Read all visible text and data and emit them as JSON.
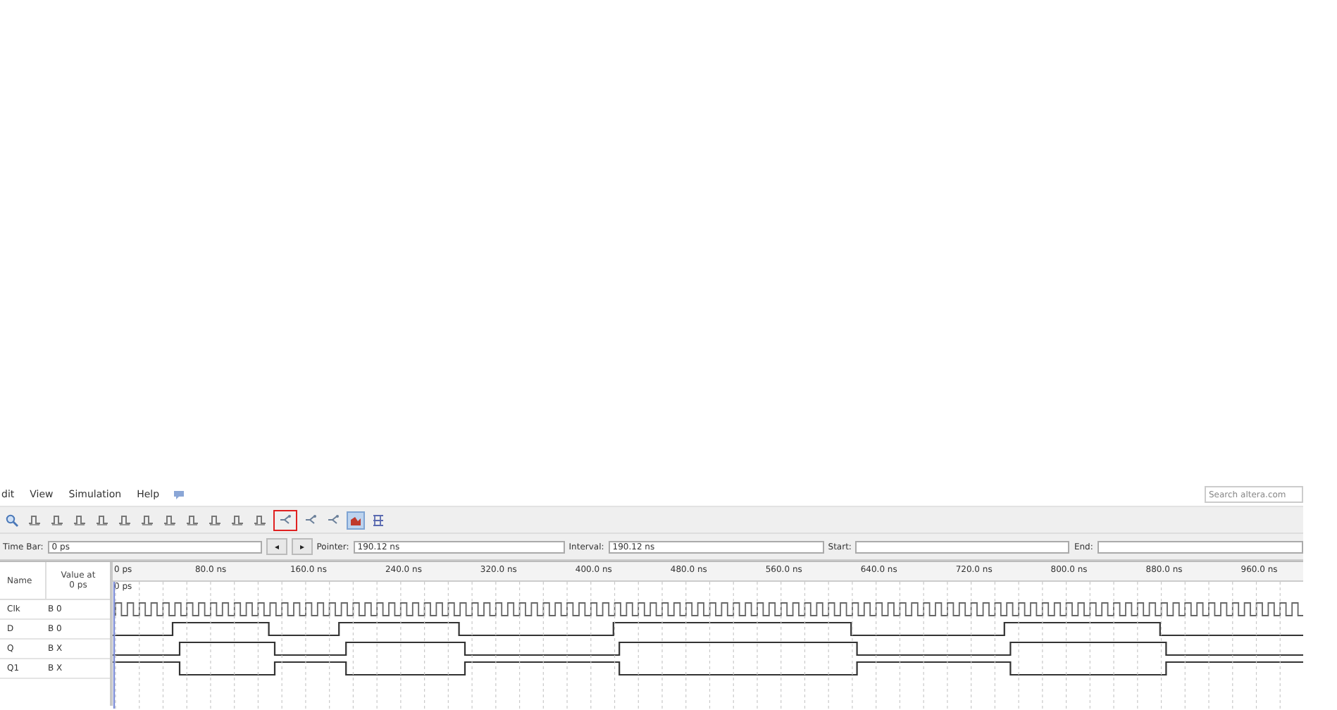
{
  "menu": [
    "dit",
    "View",
    "Simulation",
    "Help"
  ],
  "search": {
    "placeholder": "Search altera.com"
  },
  "toolbar": [
    {
      "selected": false,
      "marked": false
    },
    {
      "selected": false,
      "marked": false
    },
    {
      "selected": false,
      "marked": false
    },
    {
      "selected": false,
      "marked": false
    },
    {
      "selected": false,
      "marked": false
    },
    {
      "selected": false,
      "marked": false
    },
    {
      "selected": false,
      "marked": false
    },
    {
      "selected": false,
      "marked": false
    },
    {
      "selected": false,
      "marked": false
    },
    {
      "selected": false,
      "marked": false
    },
    {
      "selected": false,
      "marked": false
    },
    {
      "selected": false,
      "marked": false
    },
    {
      "selected": false,
      "marked": true
    },
    {
      "selected": false,
      "marked": false
    },
    {
      "selected": false,
      "marked": false
    },
    {
      "selected": true,
      "marked": false
    },
    {
      "selected": false,
      "marked": false
    }
  ],
  "time_bar": {
    "label": "Time Bar:",
    "value": "0 ps",
    "prev": "◂",
    "next": "▸",
    "pointer_label": "Pointer:",
    "pointer": "190.12 ns",
    "interval_label": "Interval:",
    "interval": "190.12 ns",
    "start_label": "Start:",
    "end_label": "End:"
  },
  "waveform": {
    "name_header": "Name",
    "value_header": "Value at",
    "value_header_time": "0 ps",
    "cursor_label": "0 ps",
    "ticks": [
      "0 ps",
      "80.0 ns",
      "160.0 ns",
      "240.0 ns",
      "320.0 ns",
      "400.0 ns",
      "480.0 ns",
      "560.0 ns",
      "640.0 ns",
      "720.0 ns",
      "800.0 ns",
      "880.0 ns",
      "960.0 ns"
    ],
    "signals": [
      {
        "name": "Clk",
        "value": "B 0",
        "kind": "clock"
      },
      {
        "name": "D",
        "value": "B 0",
        "kind": "data"
      },
      {
        "name": "Q",
        "value": "B X",
        "kind": "q"
      },
      {
        "name": "Q1",
        "value": "B X",
        "kind": "qbar"
      }
    ]
  }
}
